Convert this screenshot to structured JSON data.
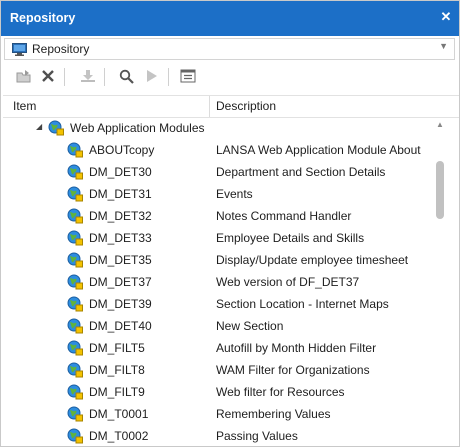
{
  "window": {
    "title": "Repository",
    "close_icon": "close-icon"
  },
  "selector": {
    "value": "Repository"
  },
  "toolbar": {
    "icons": [
      "open-icon",
      "delete-icon",
      "install-icon",
      "search-icon",
      "run-icon",
      "properties-icon"
    ]
  },
  "columns": {
    "item": "Item",
    "description": "Description"
  },
  "tree": {
    "parent": "Web Application Modules",
    "items": [
      {
        "name": "ABOUTcopy",
        "description": "LANSA Web Application Module About"
      },
      {
        "name": "DM_DET30",
        "description": "Department and Section Details"
      },
      {
        "name": "DM_DET31",
        "description": "Events"
      },
      {
        "name": "DM_DET32",
        "description": "Notes Command Handler"
      },
      {
        "name": "DM_DET33",
        "description": "Employee Details and Skills"
      },
      {
        "name": "DM_DET35",
        "description": "Display/Update employee timesheet"
      },
      {
        "name": "DM_DET37",
        "description": "Web version of DF_DET37"
      },
      {
        "name": "DM_DET39",
        "description": "Section Location - Internet Maps"
      },
      {
        "name": "DM_DET40",
        "description": "New Section"
      },
      {
        "name": "DM_FILT5",
        "description": "Autofill by Month Hidden Filter"
      },
      {
        "name": "DM_FILT8",
        "description": "WAM Filter for Organizations"
      },
      {
        "name": "DM_FILT9",
        "description": "Web filter for Resources"
      },
      {
        "name": "DM_T0001",
        "description": "Remembering Values"
      },
      {
        "name": "DM_T0002",
        "description": "Passing Values"
      }
    ]
  },
  "colors": {
    "titlebar": "#1c6fc7",
    "thumb": "#c1c1c1"
  }
}
